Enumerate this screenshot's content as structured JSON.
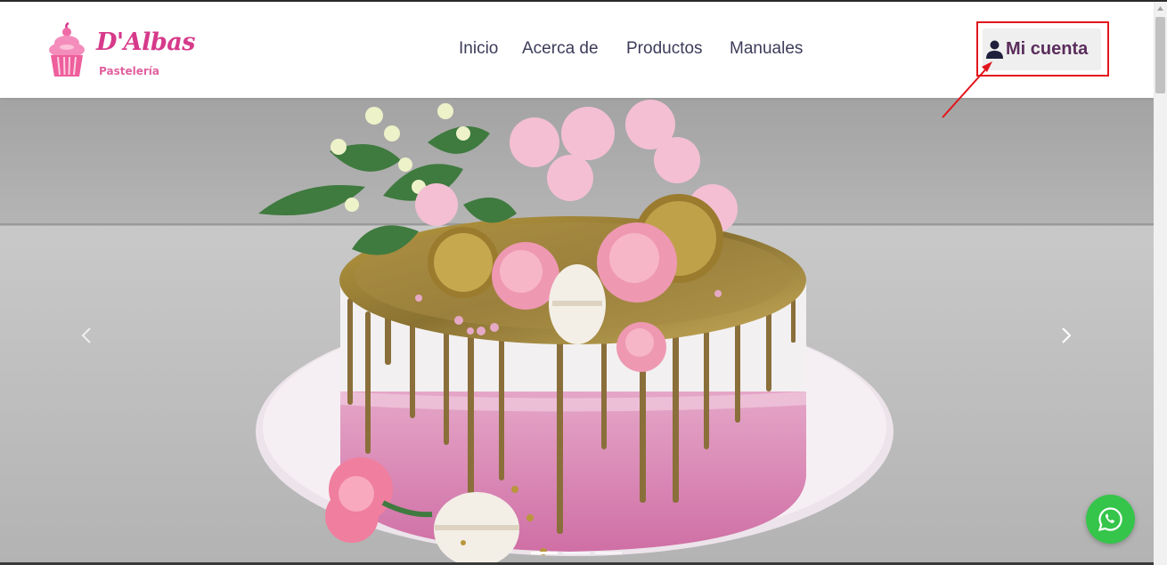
{
  "brand": {
    "name": "D'Albas",
    "tagline": "Pastelería",
    "logo_icon": "cupcake-icon",
    "color": "#d63a8a"
  },
  "nav": {
    "items": [
      {
        "label": "Inicio"
      },
      {
        "label": "Acerca de"
      },
      {
        "label": "Productos"
      },
      {
        "label": "Manuales"
      }
    ],
    "account": {
      "label": "Mi cuenta",
      "icon": "user-icon"
    }
  },
  "carousel": {
    "prev_icon": "chevron-left-icon",
    "next_icon": "chevron-right-icon",
    "slide_count": 3,
    "active_index": 0
  },
  "floating": {
    "whatsapp_icon": "whatsapp-icon",
    "color": "#35c54a"
  },
  "annotation": {
    "highlight_color": "#e3151c"
  }
}
